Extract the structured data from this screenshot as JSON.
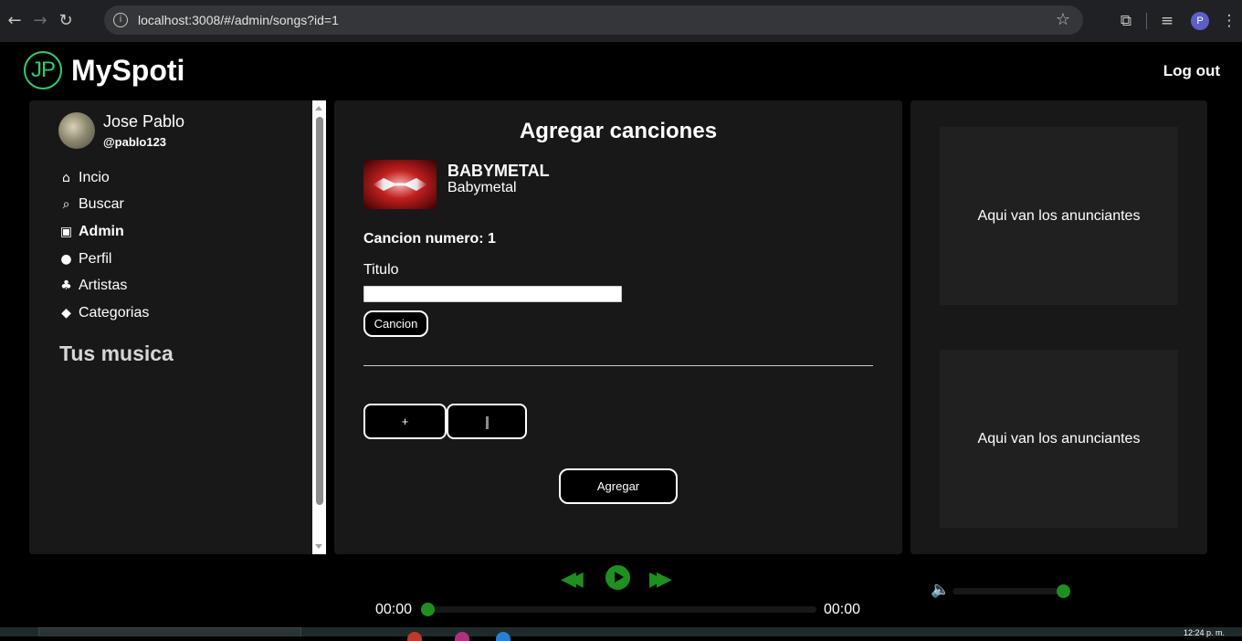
{
  "browser": {
    "url": "localhost:3008/#/admin/songs?id=1",
    "profile_initial": "P"
  },
  "header": {
    "logo_text": "JP",
    "app_name": "MySpoti",
    "logout_label": "Log out"
  },
  "sidebar": {
    "user_name": "Jose Pablo",
    "user_handle": "@pablo123",
    "items": [
      {
        "label": "Incio",
        "icon": "home-icon"
      },
      {
        "label": "Buscar",
        "icon": "search-icon"
      },
      {
        "label": "Admin",
        "icon": "briefcase-icon"
      },
      {
        "label": "Perfil",
        "icon": "user-icon"
      },
      {
        "label": "Artistas",
        "icon": "users-icon"
      },
      {
        "label": "Categorias",
        "icon": "tag-icon"
      }
    ],
    "section_title": "Tus musica"
  },
  "main": {
    "title": "Agregar canciones",
    "album_title": "BABYMETAL",
    "album_artist": "Babymetal",
    "song_number_label": "Cancion numero: 1",
    "field_label": "Titulo",
    "title_value": "",
    "cancion_button": "Cancion",
    "add_button": "+",
    "submit_button": "Agregar"
  },
  "ads": {
    "ad1": "Aqui van los anunciantes",
    "ad2": "Aqui van los anunciantes"
  },
  "player": {
    "time_current": "00:00",
    "time_total": "00:00",
    "progress": 0,
    "volume": 1.0,
    "accent_color": "#1f8f1f"
  },
  "taskbar": {
    "clock": "12:24 p. m."
  }
}
